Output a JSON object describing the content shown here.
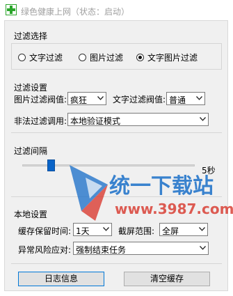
{
  "window": {
    "title": "绿色健康上网（状态：启动）"
  },
  "filter_select": {
    "section_label": "过滤选择",
    "options": [
      {
        "label": "文字过滤",
        "selected": false
      },
      {
        "label": "图片过滤",
        "selected": false
      },
      {
        "label": "文字图片过滤",
        "selected": true
      }
    ]
  },
  "filter_settings": {
    "section_label": "过滤设置",
    "image_threshold_label": "图片过滤阀值:",
    "image_threshold_value": "疯狂",
    "text_threshold_label": "文字过滤阀值:",
    "text_threshold_value": "普通",
    "illegal_call_label": "非法过滤调用:",
    "illegal_call_value": "本地验证模式"
  },
  "filter_interval": {
    "section_label": "过滤间隔",
    "value_label": "5秒",
    "level": 0.15
  },
  "local_settings": {
    "section_label": "本地设置",
    "cache_label": "缓存保留时间:",
    "cache_value": "1天",
    "screenshot_label": "截屏范围:",
    "screenshot_value": "全屏",
    "risk_label": "异常风险应对:",
    "risk_value": "强制结束任务"
  },
  "buttons": {
    "log_label": "日志信息",
    "clear_cache_label": "清空缓存"
  },
  "watermark": {
    "brand_text": "统一下载站",
    "url_text": "www.3987.com"
  },
  "colors": {
    "accent": "#0a64c8",
    "app_icon": "#2aa52a",
    "watermark_blue": "#1a6fc9",
    "watermark_red": "#d8352a"
  }
}
